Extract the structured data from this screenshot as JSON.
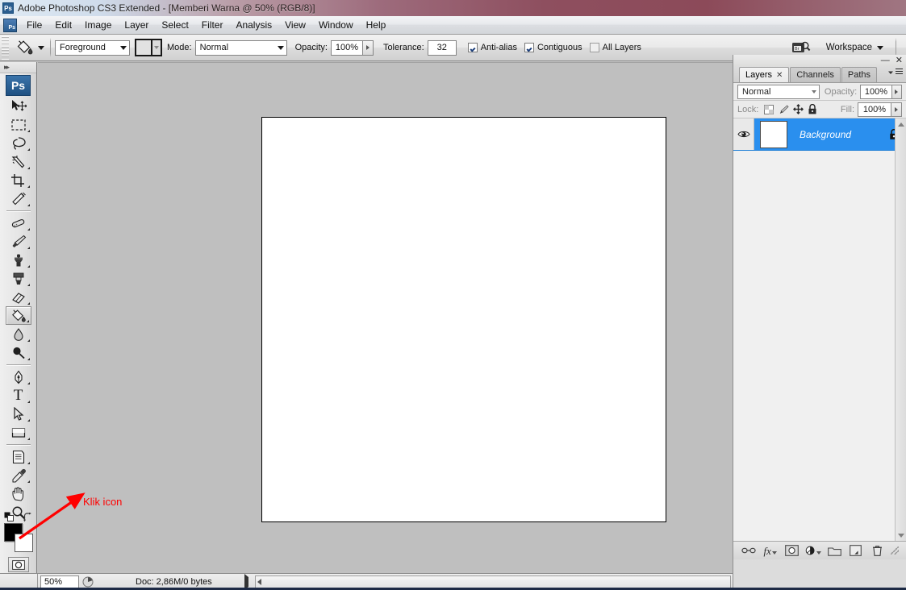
{
  "titlebar": {
    "app_title": "Adobe Photoshop CS3 Extended - ",
    "document_title": "[Memberi Warna @ 50% (RGB/8)]",
    "app_icon": "photoshop-icon"
  },
  "menubar": {
    "items": [
      {
        "label": "File"
      },
      {
        "label": "Edit"
      },
      {
        "label": "Image"
      },
      {
        "label": "Layer"
      },
      {
        "label": "Select"
      },
      {
        "label": "Filter"
      },
      {
        "label": "Analysis"
      },
      {
        "label": "View"
      },
      {
        "label": "Window"
      },
      {
        "label": "Help"
      }
    ]
  },
  "options_bar": {
    "tool_icon": "paint-bucket-icon",
    "fill_source": {
      "label": "Foreground"
    },
    "pattern_swatch": {
      "name": "pattern-picker"
    },
    "mode": {
      "label": "Mode:",
      "value": "Normal"
    },
    "opacity": {
      "label": "Opacity:",
      "value": "100%"
    },
    "tolerance": {
      "label": "Tolerance:",
      "value": "32"
    },
    "anti_alias": {
      "label": "Anti-alias",
      "checked": true
    },
    "contiguous": {
      "label": "Contiguous",
      "checked": true
    },
    "all_layers": {
      "label": "All Layers",
      "checked": false
    },
    "bridge_icon": "go-to-bridge-icon",
    "workspace": {
      "label": "Workspace"
    }
  },
  "toolbox": {
    "logo": "Ps",
    "tools": [
      {
        "name": "move-tool",
        "selected": false,
        "has_flyout": false
      },
      {
        "name": "rectangular-marquee-tool",
        "selected": false,
        "has_flyout": true
      },
      {
        "name": "lasso-tool",
        "selected": false,
        "has_flyout": true
      },
      {
        "name": "magic-wand-tool",
        "selected": false,
        "has_flyout": true
      },
      {
        "name": "crop-tool",
        "selected": false,
        "has_flyout": true
      },
      {
        "name": "slice-tool",
        "selected": false,
        "has_flyout": true
      },
      {
        "name": "healing-brush-tool",
        "selected": false,
        "has_flyout": true
      },
      {
        "name": "brush-tool",
        "selected": false,
        "has_flyout": true
      },
      {
        "name": "clone-stamp-tool",
        "selected": false,
        "has_flyout": true
      },
      {
        "name": "history-brush-tool",
        "selected": false,
        "has_flyout": true
      },
      {
        "name": "eraser-tool",
        "selected": false,
        "has_flyout": true
      },
      {
        "name": "paint-bucket-tool",
        "selected": true,
        "has_flyout": true
      },
      {
        "name": "blur-tool",
        "selected": false,
        "has_flyout": true
      },
      {
        "name": "dodge-tool",
        "selected": false,
        "has_flyout": true
      },
      {
        "name": "pen-tool",
        "selected": false,
        "has_flyout": true
      },
      {
        "name": "horizontal-type-tool",
        "selected": false,
        "has_flyout": true
      },
      {
        "name": "path-selection-tool",
        "selected": false,
        "has_flyout": true
      },
      {
        "name": "rectangle-tool",
        "selected": false,
        "has_flyout": true
      },
      {
        "name": "notes-tool",
        "selected": false,
        "has_flyout": true
      },
      {
        "name": "eyedropper-tool",
        "selected": false,
        "has_flyout": true
      },
      {
        "name": "hand-tool",
        "selected": false,
        "has_flyout": false
      },
      {
        "name": "zoom-tool",
        "selected": false,
        "has_flyout": false
      }
    ],
    "foreground_color": "#000000",
    "background_color": "#ffffff",
    "quick_mask": "edit-in-quick-mask-mode",
    "screen_mode": "change-screen-mode"
  },
  "annotation": {
    "text": "Klik icon",
    "color": "#ff0000"
  },
  "canvas": {
    "background_color": "#ffffff",
    "border_color": "#000000"
  },
  "status_bar": {
    "zoom": "50%",
    "doc_info": "Doc: 2,86M/0 bytes"
  },
  "layers_panel": {
    "tabs": [
      {
        "label": "Layers",
        "active": true,
        "closable": true
      },
      {
        "label": "Channels",
        "active": false,
        "closable": false
      },
      {
        "label": "Paths",
        "active": false,
        "closable": false
      }
    ],
    "blend_mode": "Normal",
    "opacity_label": "Opacity:",
    "opacity_value": "100%",
    "lock_label": "Lock:",
    "lock_buttons": [
      "lock-transparent-pixels-icon",
      "lock-image-pixels-icon",
      "lock-position-icon",
      "lock-all-icon"
    ],
    "fill_label": "Fill:",
    "fill_value": "100%",
    "layers": [
      {
        "name": "Background",
        "selected": true,
        "visible": true,
        "locked": true,
        "thumbnail_color": "#ffffff"
      }
    ],
    "footer_buttons": [
      "link-layers-icon",
      "layer-style-fx-icon",
      "add-layer-mask-icon",
      "new-adjustment-layer-icon",
      "new-group-icon",
      "new-layer-icon",
      "delete-layer-icon"
    ],
    "selected_color": "#2a8fee"
  }
}
